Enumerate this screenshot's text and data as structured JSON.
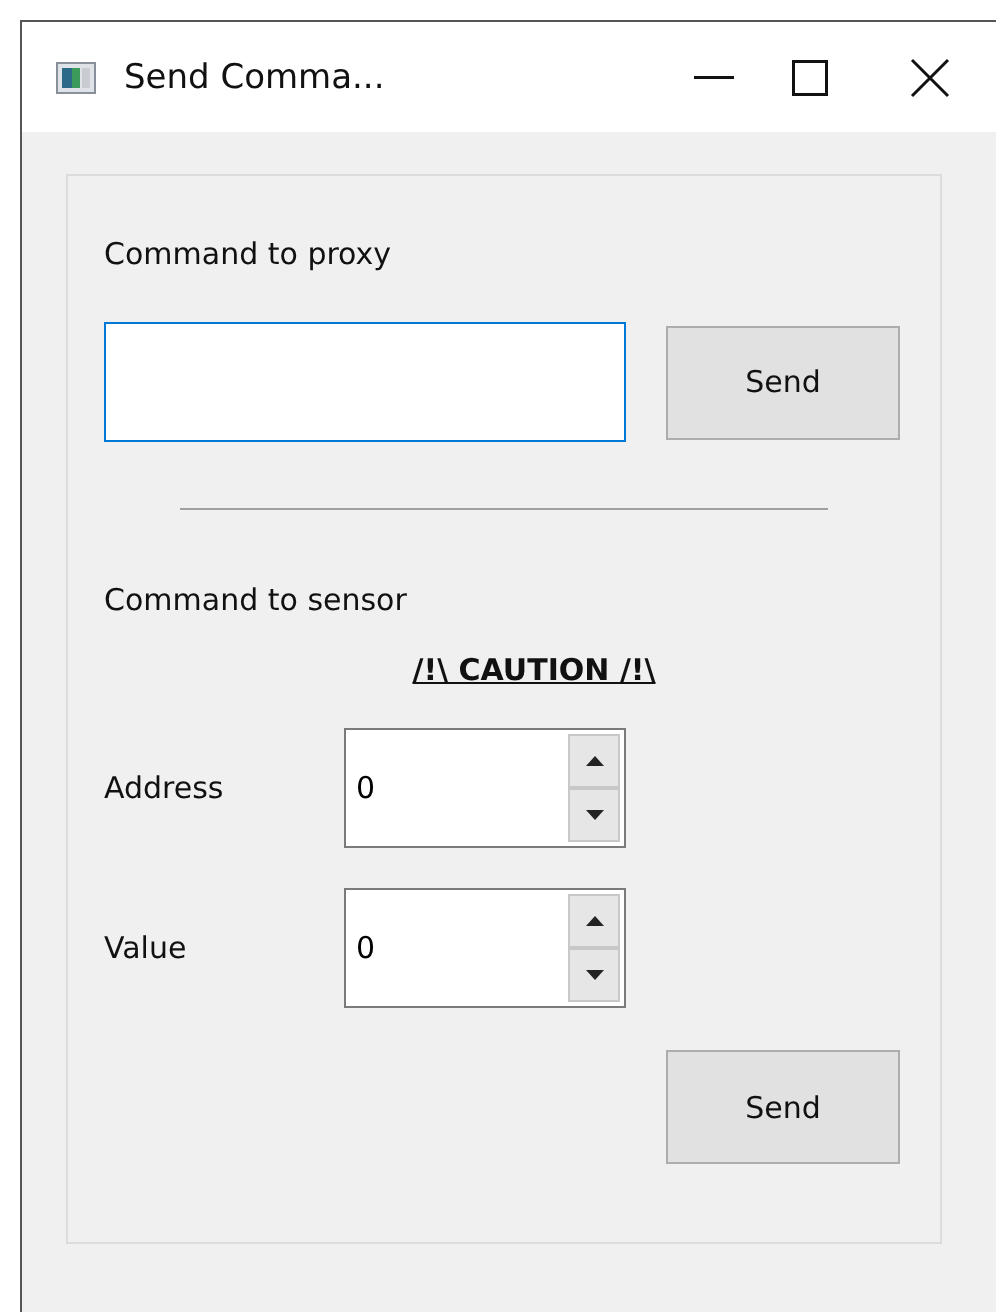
{
  "window": {
    "title": "Send Comma..."
  },
  "proxy": {
    "label": "Command to proxy",
    "input": {
      "focused": true
    },
    "button": "Send"
  },
  "sensor": {
    "label": "Command to sensor",
    "caution": "/!\\ CAUTION /!\\",
    "fields": [
      {
        "label": "Address",
        "value": "0"
      },
      {
        "label": "Value",
        "value": "0"
      }
    ],
    "button": "Send"
  }
}
